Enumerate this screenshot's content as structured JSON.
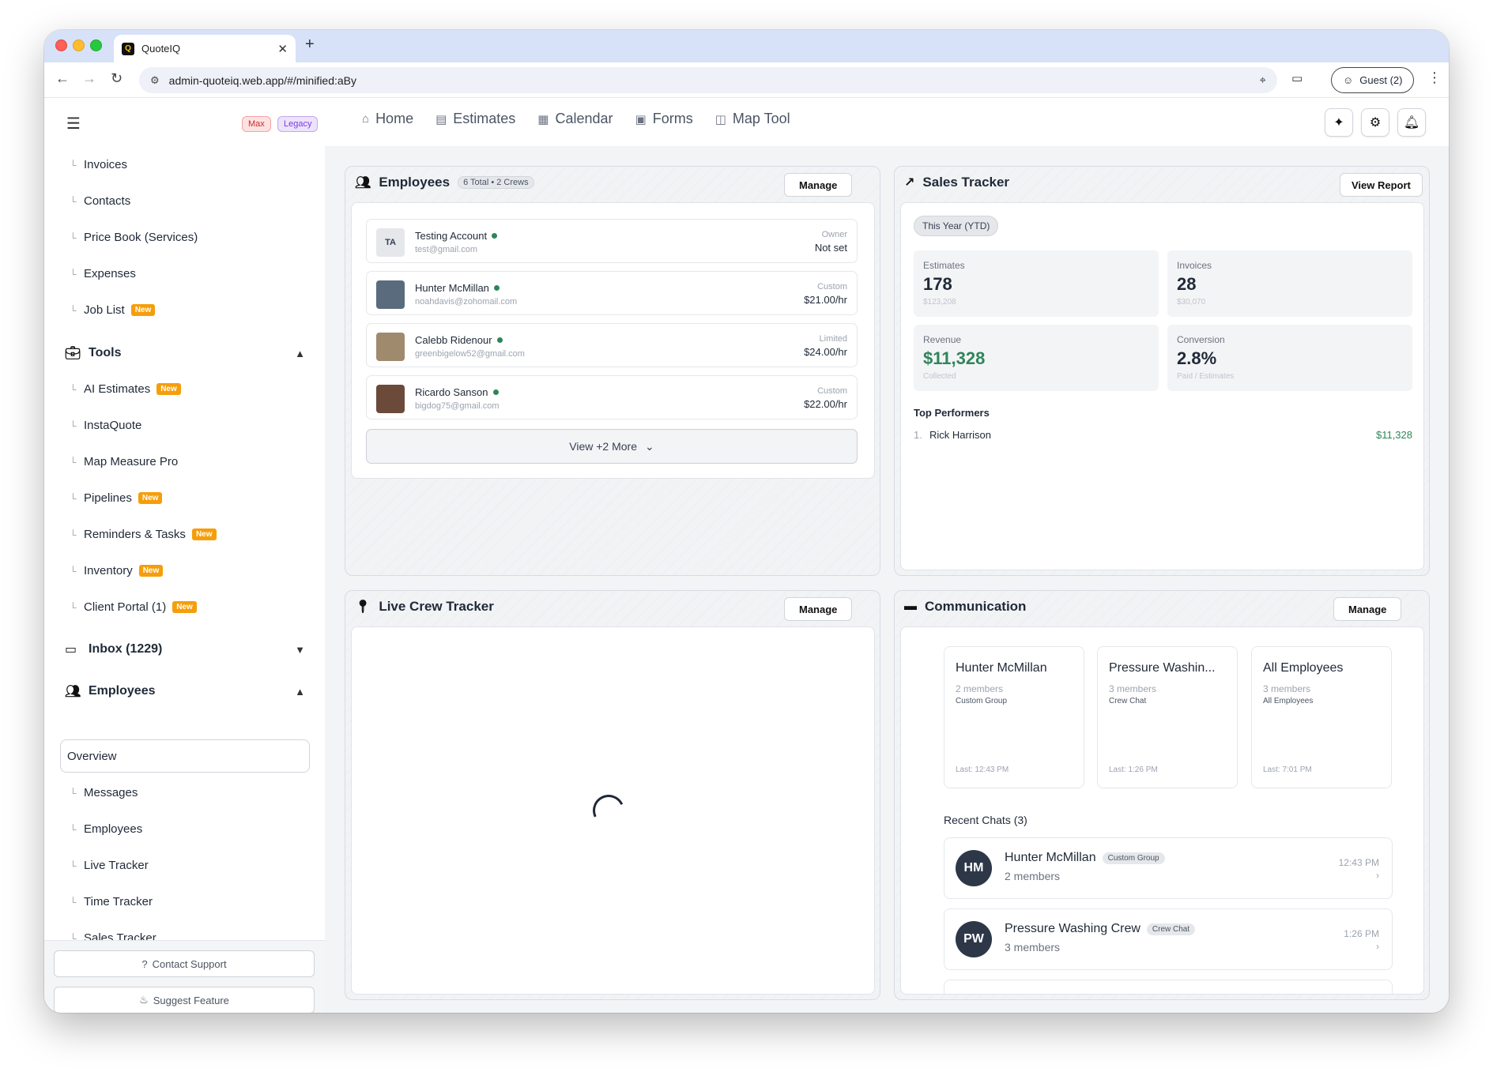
{
  "browser": {
    "tab_title": "QuoteIQ",
    "url": "admin-quoteiq.web.app/#/minified:aBy",
    "guest_label": "Guest (2)"
  },
  "header": {
    "badges": {
      "max": "Max",
      "legacy": "Legacy"
    },
    "nav": [
      {
        "label": "Home",
        "icon": "home-icon"
      },
      {
        "label": "Estimates",
        "icon": "list-icon"
      },
      {
        "label": "Calendar",
        "icon": "calendar-icon"
      },
      {
        "label": "Forms",
        "icon": "clipboard-icon"
      },
      {
        "label": "Map Tool",
        "icon": "map-icon"
      }
    ]
  },
  "sidebar": {
    "items_top": [
      {
        "label": "Invoices"
      },
      {
        "label": "Contacts"
      },
      {
        "label": "Price Book (Services)"
      },
      {
        "label": "Expenses"
      },
      {
        "label": "Job List",
        "badge": "New"
      }
    ],
    "tools_group": "Tools",
    "tools": [
      {
        "label": "AI Estimates",
        "badge": "New"
      },
      {
        "label": "InstaQuote"
      },
      {
        "label": "Map Measure Pro"
      },
      {
        "label": "Pipelines",
        "badge": "New"
      },
      {
        "label": "Reminders & Tasks",
        "badge": "New"
      },
      {
        "label": "Inventory",
        "badge": "New"
      },
      {
        "label": "Client Portal (1)",
        "badge": "New"
      }
    ],
    "inbox_group": "Inbox (1229)",
    "employees_group": "Employees",
    "overview": "Overview",
    "employees_items": [
      {
        "label": "Messages"
      },
      {
        "label": "Employees"
      },
      {
        "label": "Live Tracker"
      },
      {
        "label": "Time Tracker"
      },
      {
        "label": "Sales Tracker"
      }
    ],
    "footer": {
      "support": "Contact Support",
      "suggest": "Suggest Feature"
    }
  },
  "employees_panel": {
    "title": "Employees",
    "count": "6 Total • 2 Crews",
    "manage": "Manage",
    "rows": [
      {
        "initials": "TA",
        "name": "Testing Account",
        "email": "test@gmail.com",
        "role": "Owner",
        "rate": "Not set"
      },
      {
        "initials": "",
        "name": "Hunter McMillan",
        "email": "noahdavis@zohomail.com",
        "role": "Custom",
        "rate": "$21.00/hr"
      },
      {
        "initials": "",
        "name": "Calebb Ridenour",
        "email": "greenbigelow52@gmail.com",
        "role": "Limited",
        "rate": "$24.00/hr"
      },
      {
        "initials": "",
        "name": "Ricardo Sanson",
        "email": "bigdog75@gmail.com",
        "role": "Custom",
        "rate": "$22.00/hr"
      }
    ],
    "view_more": "View +2 More"
  },
  "sales_panel": {
    "title": "Sales Tracker",
    "view_report": "View Report",
    "period": "This Year (YTD)",
    "stats": [
      {
        "label": "Estimates",
        "value": "178",
        "sub": "$123,208"
      },
      {
        "label": "Invoices",
        "value": "28",
        "sub": "$30,070"
      },
      {
        "label": "Revenue",
        "value": "$11,328",
        "sub": "Collected"
      },
      {
        "label": "Conversion",
        "value": "2.8%",
        "sub": "Paid / Estimates"
      }
    ],
    "top_performers_label": "Top Performers",
    "top_performers": [
      {
        "rank": "1.",
        "name": "Rick Harrison",
        "amount": "$11,328"
      }
    ]
  },
  "crew_panel": {
    "title": "Live Crew Tracker",
    "manage": "Manage"
  },
  "comm_panel": {
    "title": "Communication",
    "manage": "Manage",
    "groups": [
      {
        "title": "Hunter McMillan",
        "members": "2 members",
        "type": "Custom Group",
        "last": "Last: 12:43 PM"
      },
      {
        "title": "Pressure Washin...",
        "members": "3 members",
        "type": "Crew Chat",
        "last": "Last: 1:26 PM"
      },
      {
        "title": "All Employees",
        "members": "3 members",
        "type": "All Employees",
        "last": "Last: 7:01 PM"
      }
    ],
    "recent_label": "Recent Chats (3)",
    "recent": [
      {
        "initials": "HM",
        "name": "Hunter McMillan",
        "tag": "Custom Group",
        "members": "2 members",
        "time": "12:43 PM"
      },
      {
        "initials": "PW",
        "name": "Pressure Washing Crew",
        "tag": "Crew Chat",
        "members": "3 members",
        "time": "1:26 PM"
      }
    ]
  },
  "colors": {
    "accent_green": "#2f855a",
    "badge_orange": "#f59e0b",
    "avatar_dark": "#2d3748"
  }
}
